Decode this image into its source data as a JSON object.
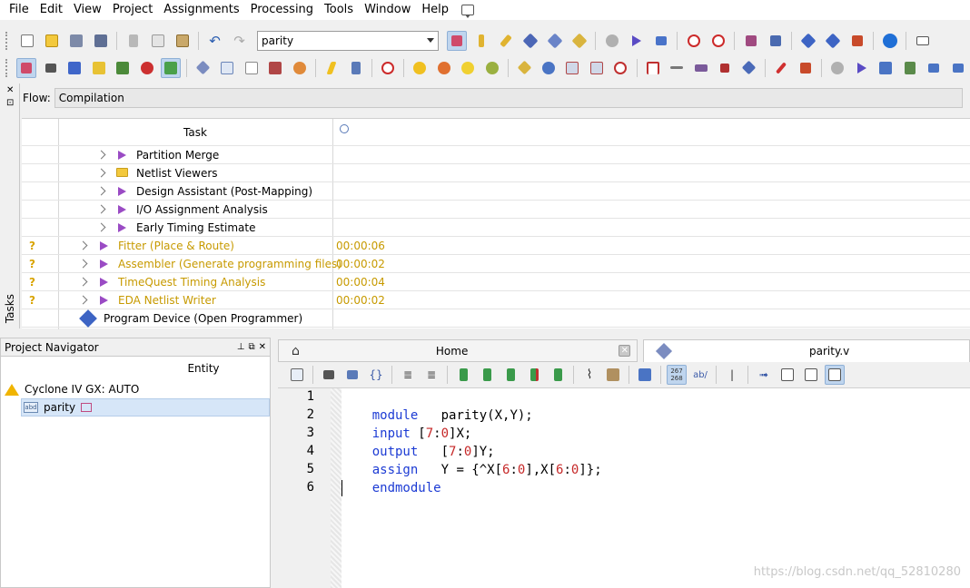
{
  "menubar": {
    "items": [
      "File",
      "Edit",
      "View",
      "Project",
      "Assignments",
      "Processing",
      "Tools",
      "Window",
      "Help"
    ]
  },
  "toolbar": {
    "revision_value": "parity"
  },
  "tasks_panel": {
    "vertical_label": "Tasks",
    "flow_label": "Flow:",
    "flow_value": "Compilation",
    "column_task": "Task",
    "rows": [
      {
        "name": "Partition Merge",
        "time": "",
        "status": "",
        "icon": "play-icon"
      },
      {
        "name": "Netlist Viewers",
        "time": "",
        "status": "",
        "icon": "folder-icon"
      },
      {
        "name": "Design Assistant (Post-Mapping)",
        "time": "",
        "status": "",
        "icon": "play-icon"
      },
      {
        "name": "I/O Assignment Analysis",
        "time": "",
        "status": "",
        "icon": "play-icon"
      },
      {
        "name": "Early Timing Estimate",
        "time": "",
        "status": "",
        "icon": "play-icon"
      },
      {
        "name": "Fitter (Place & Route)",
        "time": "00:00:06",
        "status": "?",
        "icon": "play-icon"
      },
      {
        "name": "Assembler (Generate programming files)",
        "time": "00:00:02",
        "status": "?",
        "icon": "play-icon"
      },
      {
        "name": "TimeQuest Timing Analysis",
        "time": "00:00:04",
        "status": "?",
        "icon": "play-icon"
      },
      {
        "name": "EDA Netlist Writer",
        "time": "00:00:02",
        "status": "?",
        "icon": "play-icon"
      },
      {
        "name": "Program Device (Open Programmer)",
        "time": "",
        "status": "",
        "icon": "programmer-icon"
      }
    ]
  },
  "navigator": {
    "title": "Project Navigator",
    "column": "Entity",
    "device": "Cyclone IV GX: AUTO",
    "entity": "parity"
  },
  "editor": {
    "home_tab": "Home",
    "file_tab": "parity.v",
    "lines": [
      {
        "n": "1",
        "kw": "module",
        "rest": "   parity(X,Y);"
      },
      {
        "n": "2",
        "kw": "input",
        "rest": " [7:0]X;"
      },
      {
        "n": "3",
        "kw": "output",
        "rest": "   [7:0]Y;"
      },
      {
        "n": "4",
        "kw": "assign",
        "rest": "   Y = {^X[6:0],X[6:0]};"
      },
      {
        "n": "5",
        "kw": "endmodule",
        "rest": ""
      },
      {
        "n": "6",
        "kw": "",
        "rest": ""
      }
    ]
  },
  "watermark": "https://blog.csdn.net/qq_52810280",
  "colors": {
    "keyword": "#1c3bd4",
    "number": "#c62828",
    "warning_text": "#c79a00",
    "task_icon": "#9a4bc4"
  }
}
